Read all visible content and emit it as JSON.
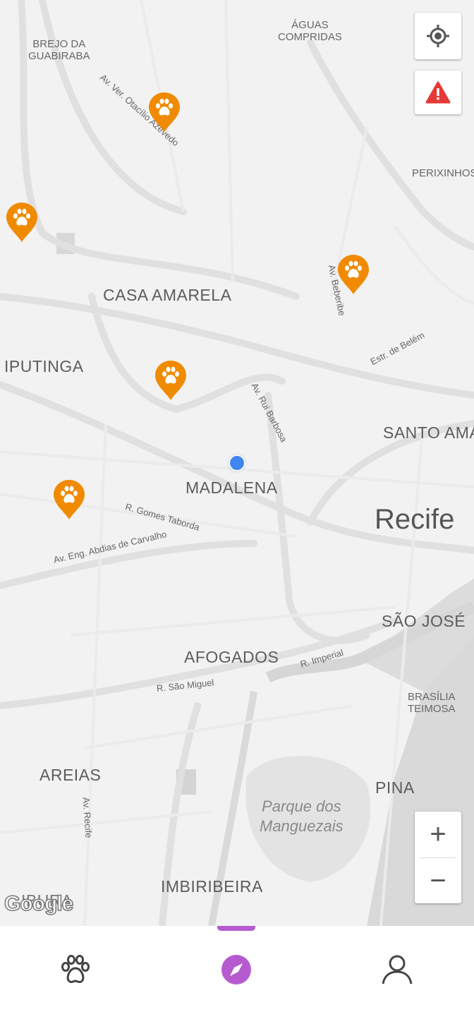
{
  "map": {
    "neighborhoods": {
      "brejo": "BREJO DA\nGUABIRABA",
      "aguas": "ÁGUAS\nCOMPRIDAS",
      "perixinhos": "PERIXINHOS",
      "casa_amarela": "CASA AMARELA",
      "iputinga": "IPUTINGA",
      "santo_amaro": "SANTO AMA",
      "madalena": "MADALENA",
      "sao_jose": "SÃO JOSÉ",
      "afogados": "AFOGADOS",
      "brasilia": "BRASÍLIA\nTEIMOSA",
      "areias": "AREIAS",
      "pina": "PINA",
      "imbiribeira": "IMBIRIBEIRA",
      "ibura": "IBURA"
    },
    "city": "Recife",
    "park": "Parque dos\nManguezais",
    "streets": {
      "otacilio": "Av. Ver. Otacílio Azevedo",
      "beberibe": "Av. Beberibe",
      "belem": "Estr. de Belém",
      "rui_barbosa": "Av. Rui Barbosa",
      "gomes_taborda": "R. Gomes Taborda",
      "abdias": "Av. Eng. Abdias de Carvalho",
      "imperial": "R. Imperial",
      "sao_miguel": "R. São Miguel",
      "recife": "Av. Recife"
    },
    "attribution": "Google",
    "pin_icon": "paw-icon",
    "pin_color": "#f08a00",
    "user_location_color": "#3f86f0"
  },
  "controls": {
    "locate_icon": "my-location-icon",
    "alert_icon": "warning-icon",
    "alert_color": "#e53935",
    "zoom_in": "+",
    "zoom_out": "−"
  },
  "bottom_nav": {
    "items": [
      {
        "icon": "paw-icon",
        "active": false
      },
      {
        "icon": "compass-icon",
        "active": true
      },
      {
        "icon": "profile-icon",
        "active": false
      }
    ],
    "active_color": "#b65bcf",
    "inactive_color": "#444444"
  }
}
